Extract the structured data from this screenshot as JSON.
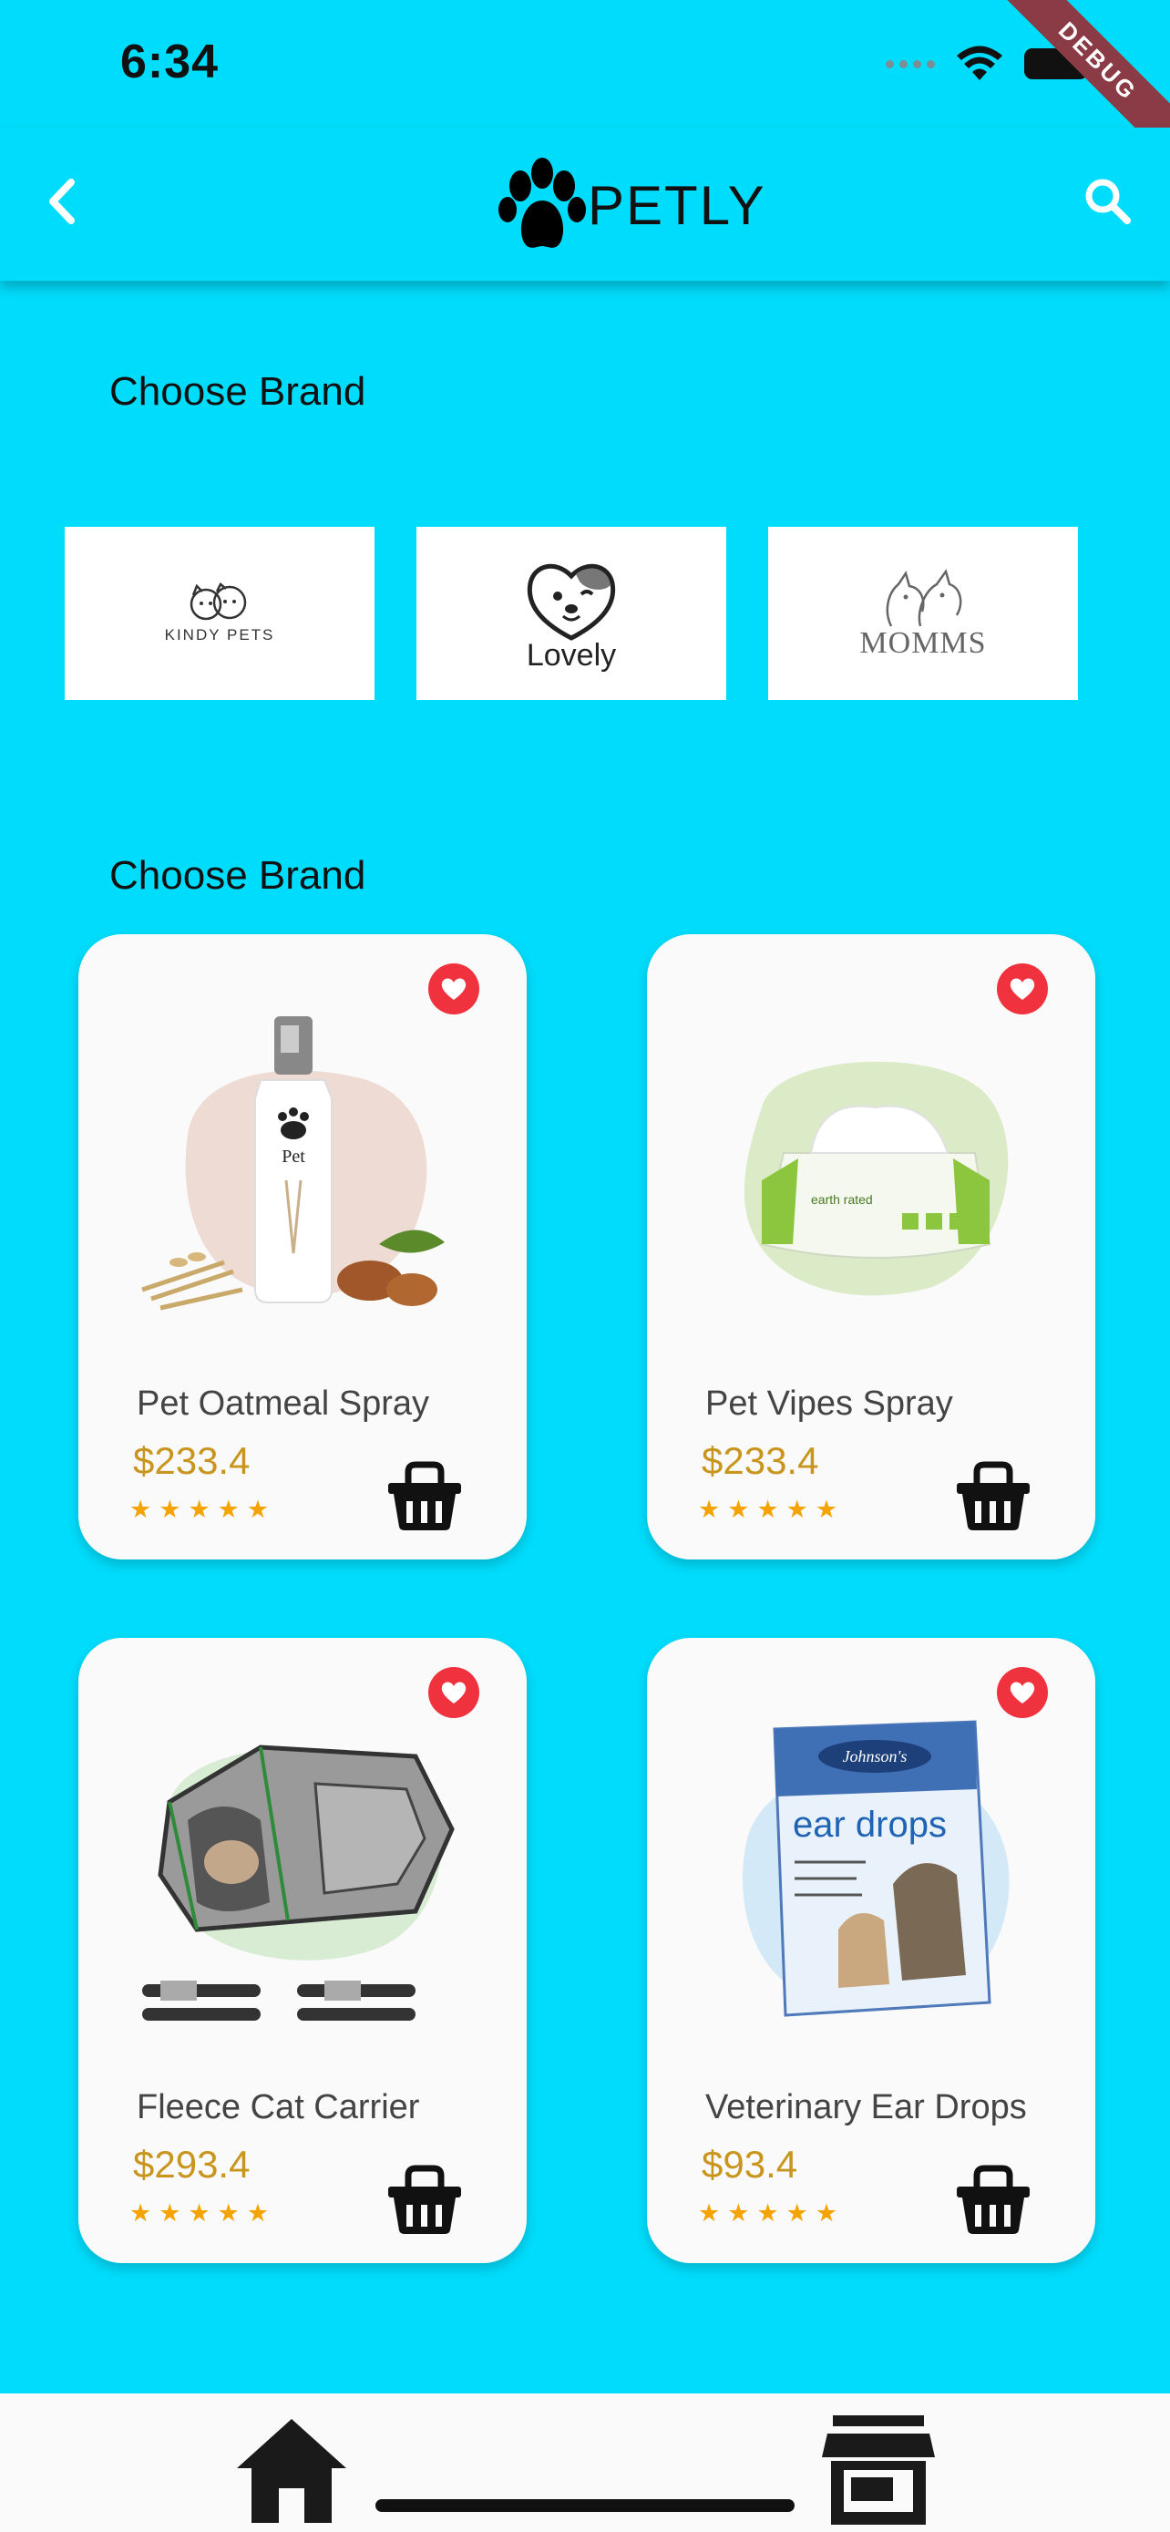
{
  "status_bar": {
    "time": "6:34",
    "debug_label": "DEBUG"
  },
  "app_bar": {
    "title": "PETLY",
    "back_icon": "back-arrow-icon",
    "search_icon": "search-icon",
    "logo_icon": "paw-icon"
  },
  "sections": {
    "brands_title": "Choose Brand",
    "products_title": "Choose Brand"
  },
  "brands": [
    {
      "name": "KINDY PETS",
      "icon": "kindy-pets-logo"
    },
    {
      "name": "Lovely",
      "icon": "lovely-dog-logo"
    },
    {
      "name": "MOMMS",
      "icon": "momms-logo"
    }
  ],
  "products": [
    {
      "name": "Pet Oatmeal Spray",
      "price": "$233.4",
      "rating": 5,
      "image": "spray-bottle-image",
      "blob_color": "#EEDBD3"
    },
    {
      "name": "Pet Vipes Spray",
      "price": "$233.4",
      "rating": 5,
      "image": "wipes-pack-image",
      "blob_color": "#DCEBC7"
    },
    {
      "name": "Fleece Cat Carrier",
      "price": "$293.4",
      "rating": 5,
      "image": "cat-carrier-image",
      "blob_color": "#D8ECD4"
    },
    {
      "name": "Veterinary Ear Drops",
      "price": "$93.4",
      "rating": 5,
      "image": "ear-drops-box-image",
      "blob_color": "#D4E9F7"
    }
  ],
  "colors": {
    "background": "#00DCFB",
    "card": "#FAFAFA",
    "favorite": "#F0323E",
    "price": "#C8961E",
    "star": "#F5A300"
  },
  "bottom_nav": {
    "items": [
      {
        "icon": "home-icon"
      },
      {
        "icon": "store-icon"
      }
    ]
  }
}
